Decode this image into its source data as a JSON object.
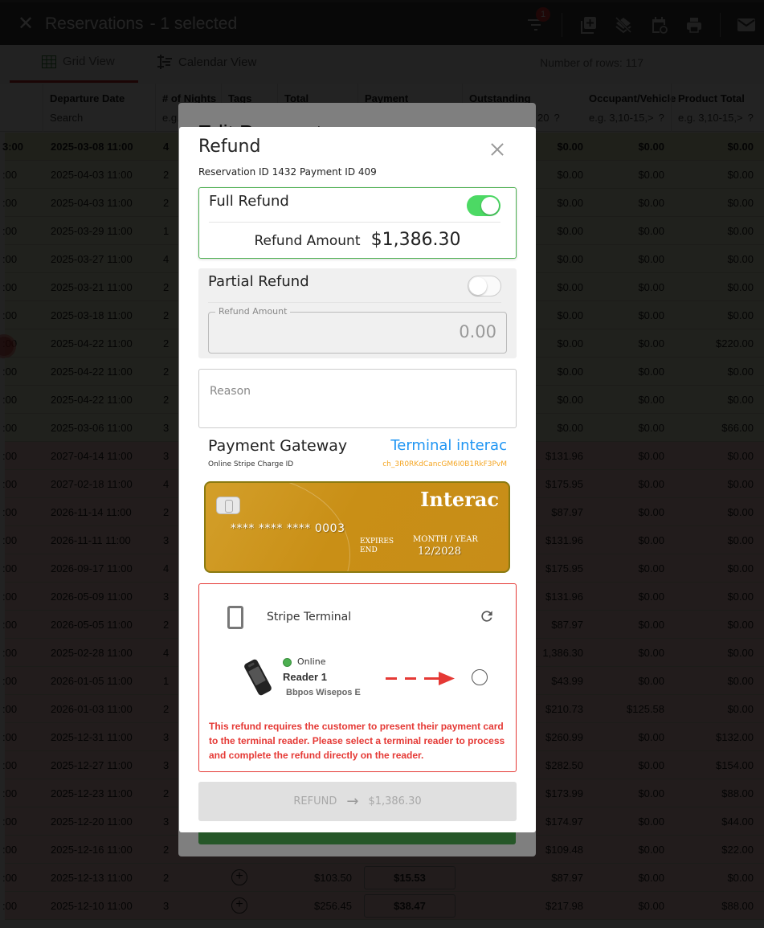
{
  "topbar": {
    "close_icon": "close-icon",
    "title": "Reservations",
    "selected_text": "- 1 selected",
    "filter_badge": "1",
    "icons": [
      "filter-icon",
      "add-copy-icon",
      "layers-off-icon",
      "calendar-sync-icon",
      "print-icon",
      "mail-icon"
    ]
  },
  "tabs": {
    "grid_view": "Grid View",
    "calendar_view": "Calendar View",
    "rows_count": "Number of rows: 117"
  },
  "grid": {
    "columns": [
      {
        "header": "Departure Date",
        "filter": "Search"
      },
      {
        "header": "# of Nights",
        "filter": "e.g."
      },
      {
        "header": "Tags",
        "filter": ""
      },
      {
        "header": "Total",
        "filter": ""
      },
      {
        "header": "Payment",
        "filter": ""
      },
      {
        "header": "Outstanding",
        "filter": "20",
        "help": "?"
      },
      {
        "header": "Occupant/Vehicle",
        "filter": "e.g. 3,10-15,>",
        "help": "?"
      },
      {
        "header": "Product Total",
        "filter": "e.g. 3,10-15,>",
        "help": "?"
      }
    ],
    "rows": [
      {
        "arrival": "3:00",
        "departure": "2025-03-08 11:00",
        "nights": "4",
        "outstanding": "$0.00",
        "occupant": "$0.00",
        "product": "$0.00",
        "status": "green",
        "selected": true
      },
      {
        "arrival": ":00",
        "departure": "2025-04-03 11:00",
        "nights": "2",
        "outstanding": "$0.00",
        "occupant": "$0.00",
        "product": "$0.00",
        "status": "green"
      },
      {
        "arrival": ":00",
        "departure": "2025-04-03 11:00",
        "nights": "2",
        "outstanding": "$0.00",
        "occupant": "$0.00",
        "product": "$0.00",
        "status": "green"
      },
      {
        "arrival": ":00",
        "departure": "2025-03-29 11:00",
        "nights": "1",
        "outstanding": "$0.00",
        "occupant": "$0.00",
        "product": "$0.00",
        "status": "green"
      },
      {
        "arrival": ":00",
        "departure": "2025-03-27 11:00",
        "nights": "4",
        "outstanding": "$0.00",
        "occupant": "$0.00",
        "product": "$0.00",
        "status": "green"
      },
      {
        "arrival": ":00",
        "departure": "2025-03-21 11:00",
        "nights": "2",
        "outstanding": "$0.00",
        "occupant": "$0.00",
        "product": "$0.00",
        "status": "green"
      },
      {
        "arrival": ":00",
        "departure": "2025-03-18 11:00",
        "nights": "2",
        "outstanding": "$0.00",
        "occupant": "$0.00",
        "product": "$0.00",
        "status": "green"
      },
      {
        "arrival": ":00",
        "departure": "2025-04-22 11:00",
        "nights": "2",
        "outstanding": "$0.00",
        "occupant": "$0.00",
        "product": "$220.00",
        "status": "green",
        "marker": true
      },
      {
        "arrival": ":00",
        "departure": "2025-04-22 11:00",
        "nights": "2",
        "outstanding": "$0.00",
        "occupant": "$0.00",
        "product": "$0.00",
        "status": "green"
      },
      {
        "arrival": ":00",
        "departure": "2025-04-22 11:00",
        "nights": "2",
        "outstanding": "$0.00",
        "occupant": "$0.00",
        "product": "$0.00",
        "status": "green"
      },
      {
        "arrival": ":00",
        "departure": "2025-03-06 11:00",
        "nights": "3",
        "outstanding": "$0.00",
        "occupant": "$0.00",
        "product": "$66.00",
        "status": "green"
      },
      {
        "arrival": ":00",
        "departure": "2027-04-14 11:00",
        "nights": "3",
        "outstanding": "$131.96",
        "occupant": "$0.00",
        "product": "$0.00",
        "status": "red"
      },
      {
        "arrival": ":00",
        "departure": "2027-02-18 11:00",
        "nights": "4",
        "outstanding": "$175.95",
        "occupant": "$0.00",
        "product": "$0.00",
        "status": "red"
      },
      {
        "arrival": ":00",
        "departure": "2026-11-14 11:00",
        "nights": "2",
        "outstanding": "$87.97",
        "occupant": "$0.00",
        "product": "$0.00",
        "status": "red"
      },
      {
        "arrival": ":00",
        "departure": "2026-11-11 11:00",
        "nights": "3",
        "outstanding": "$131.96",
        "occupant": "$0.00",
        "product": "$0.00",
        "status": "red"
      },
      {
        "arrival": ":00",
        "departure": "2026-09-17 11:00",
        "nights": "4",
        "outstanding": "$175.95",
        "occupant": "$0.00",
        "product": "$0.00",
        "status": "red"
      },
      {
        "arrival": ":00",
        "departure": "2026-05-09 11:00",
        "nights": "3",
        "outstanding": "$131.96",
        "occupant": "$0.00",
        "product": "$0.00",
        "status": "red"
      },
      {
        "arrival": ":00",
        "departure": "2026-05-05 11:00",
        "nights": "2",
        "outstanding": "$87.97",
        "occupant": "$0.00",
        "product": "$0.00",
        "status": "red"
      },
      {
        "arrival": ":00",
        "departure": "2025-02-28 11:00",
        "nights": "4",
        "outstanding": "1,386.30",
        "occupant": "$0.00",
        "product": "$0.00",
        "status": "red"
      },
      {
        "arrival": ":00",
        "departure": "2026-01-05 11:00",
        "nights": "1",
        "outstanding": "$43.99",
        "occupant": "$0.00",
        "product": "$0.00",
        "status": "red"
      },
      {
        "arrival": ":00",
        "departure": "2026-01-03 11:00",
        "nights": "2",
        "outstanding": "$210.73",
        "occupant": "$125.58",
        "product": "$0.00",
        "status": "red"
      },
      {
        "arrival": ":00",
        "departure": "2025-12-31 11:00",
        "nights": "3",
        "outstanding": "$260.99",
        "occupant": "$0.00",
        "product": "$132.00",
        "status": "red"
      },
      {
        "arrival": ":00",
        "departure": "2025-12-27 11:00",
        "nights": "3",
        "outstanding": "$282.50",
        "occupant": "$0.00",
        "product": "$154.00",
        "status": "red"
      },
      {
        "arrival": ":00",
        "departure": "2025-12-23 11:00",
        "nights": "2",
        "outstanding": "$173.99",
        "occupant": "$0.00",
        "product": "$88.00",
        "status": "red"
      },
      {
        "arrival": ":00",
        "departure": "2025-12-20 11:00",
        "nights": "3",
        "outstanding": "$174.97",
        "occupant": "$0.00",
        "product": "$44.00",
        "status": "red"
      },
      {
        "arrival": ":00",
        "departure": "2025-12-16 11:00",
        "nights": "2",
        "outstanding": "$109.48",
        "occupant": "$0.00",
        "product": "$22.00",
        "status": "red"
      },
      {
        "arrival": ":00",
        "departure": "2025-12-13 11:00",
        "nights": "2",
        "total": "$103.50",
        "payment": "$15.53",
        "outstanding": "$87.97",
        "occupant": "$0.00",
        "product": "$0.00",
        "status": "red"
      },
      {
        "arrival": ":00",
        "departure": "2025-12-10 11:00",
        "nights": "3",
        "total": "$256.45",
        "payment": "$38.47",
        "outstanding": "$217.98",
        "occupant": "$0.00",
        "product": "$88.00",
        "status": "red"
      }
    ]
  },
  "edit_payment_modal": {
    "title": "Edit Payment"
  },
  "refund_modal": {
    "title": "Refund",
    "subtitle": "Reservation ID 1432 Payment ID 409",
    "full_refund": {
      "label": "Full Refund",
      "enabled": true,
      "amount_label": "Refund Amount",
      "amount": "$1,386.30"
    },
    "partial_refund": {
      "label": "Partial Refund",
      "enabled": false,
      "field_label": "Refund Amount",
      "field_value": "0.00"
    },
    "reason": {
      "placeholder": "Reason",
      "value": ""
    },
    "payment_gateway": {
      "label": "Payment Gateway",
      "value": "Terminal interac",
      "charge_label": "Online Stripe Charge ID",
      "charge_id": "ch_3R0RKdCancGM6I0B1RkF3PvM"
    },
    "card": {
      "brand": "Interac",
      "number": "**** **** **** 0003",
      "expires_label": "EXPIRES",
      "end_label": "END",
      "month_year_label": "MONTH / YEAR",
      "expiry": "12/2028"
    },
    "terminal": {
      "title": "Stripe Terminal",
      "reader": {
        "status": "Online",
        "name": "Reader 1",
        "model": "Bbpos Wisepos E",
        "selected": false
      },
      "warning": "This refund requires the customer to present their payment card to the terminal reader. Please select a terminal reader to process and complete the refund directly on the reader."
    },
    "submit": {
      "label": "REFUND",
      "amount": "$1,386.30",
      "enabled": false
    }
  },
  "colors": {
    "accent_green": "#4caf50",
    "toggle_on": "#4cd964",
    "error_red": "#e53935",
    "gateway_blue": "#2196f3",
    "charge_orange": "#f5a623",
    "card_gold": "#c98f16"
  }
}
